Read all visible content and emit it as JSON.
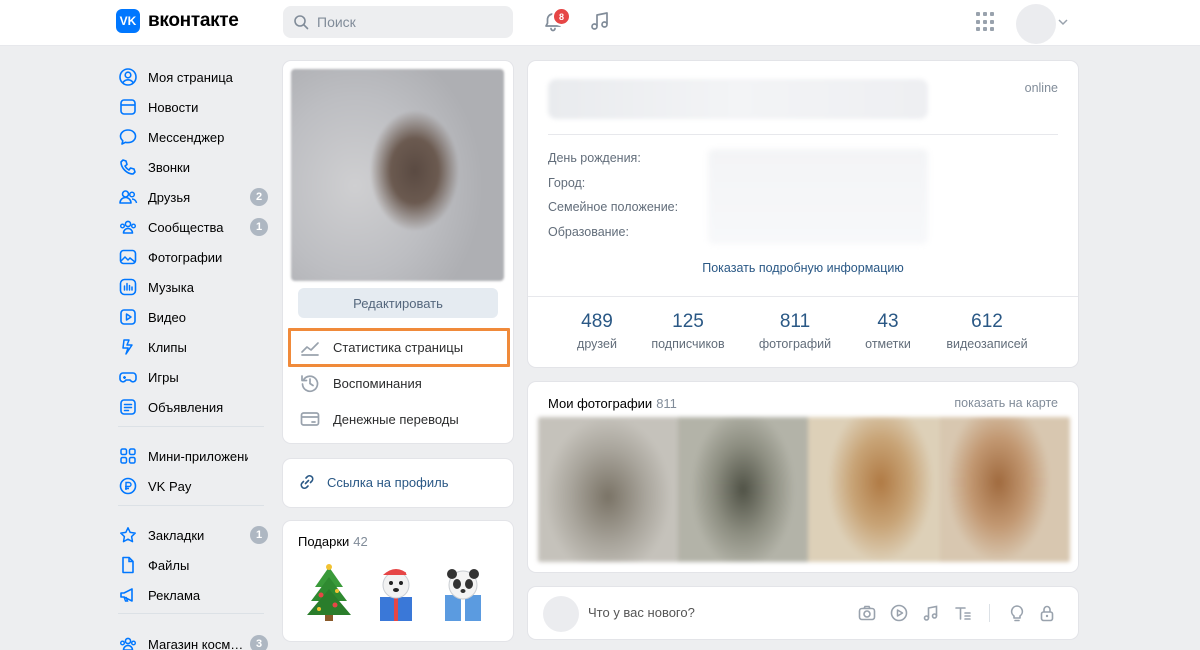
{
  "header": {
    "logo_badge": "VK",
    "logo_text": "вконтакте",
    "search_placeholder": "Поиск",
    "notifications_count": "8"
  },
  "sidebar": {
    "items": [
      {
        "label": "Моя страница",
        "icon": "user-circle-icon"
      },
      {
        "label": "Новости",
        "icon": "newsfeed-icon"
      },
      {
        "label": "Мессенджер",
        "icon": "message-icon"
      },
      {
        "label": "Звонки",
        "icon": "phone-icon"
      },
      {
        "label": "Друзья",
        "icon": "friends-icon",
        "count": "2"
      },
      {
        "label": "Сообщества",
        "icon": "communities-icon",
        "count": "1"
      },
      {
        "label": "Фотографии",
        "icon": "photo-icon"
      },
      {
        "label": "Музыка",
        "icon": "music-icon"
      },
      {
        "label": "Видео",
        "icon": "video-icon"
      },
      {
        "label": "Клипы",
        "icon": "clips-icon"
      },
      {
        "label": "Игры",
        "icon": "gamepad-icon"
      },
      {
        "label": "Объявления",
        "icon": "classifieds-icon"
      },
      {
        "label": "Мини-приложения",
        "icon": "mini-apps-icon"
      },
      {
        "label": "VK Pay",
        "icon": "vk-pay-icon"
      },
      {
        "label": "Закладки",
        "icon": "star-icon",
        "count": "1"
      },
      {
        "label": "Файлы",
        "icon": "file-icon"
      },
      {
        "label": "Реклама",
        "icon": "megaphone-icon"
      },
      {
        "label": "Магазин косм…",
        "icon": "store-icon",
        "count": "3"
      }
    ]
  },
  "profile_card": {
    "edit_label": "Редактировать",
    "menu": [
      {
        "label": "Статистика страницы",
        "icon": "statistics-icon"
      },
      {
        "label": "Воспоминания",
        "icon": "memories-icon"
      },
      {
        "label": "Денежные переводы",
        "icon": "money-transfer-icon"
      }
    ]
  },
  "profile_link": {
    "label": "Ссылка на профиль"
  },
  "gifts": {
    "title": "Подарки",
    "count": "42"
  },
  "info": {
    "status": "online",
    "labels": [
      "День рождения:",
      "Город:",
      "Семейное положение:",
      "Образование:"
    ],
    "show_more": "Показать подробную информацию"
  },
  "counters": [
    {
      "num": "489",
      "label": "друзей"
    },
    {
      "num": "125",
      "label": "подписчиков"
    },
    {
      "num": "811",
      "label": "фотографий"
    },
    {
      "num": "43",
      "label": "отметки"
    },
    {
      "num": "612",
      "label": "видеозаписей"
    }
  ],
  "photos": {
    "title": "Мои фотографии",
    "count": "811",
    "map_link": "показать на карте"
  },
  "post": {
    "placeholder": "Что у вас нового?"
  },
  "colors": {
    "accent": "#0077ff",
    "link": "#2a5885",
    "highlight": "#f08a3a",
    "badge": "#e64646"
  }
}
